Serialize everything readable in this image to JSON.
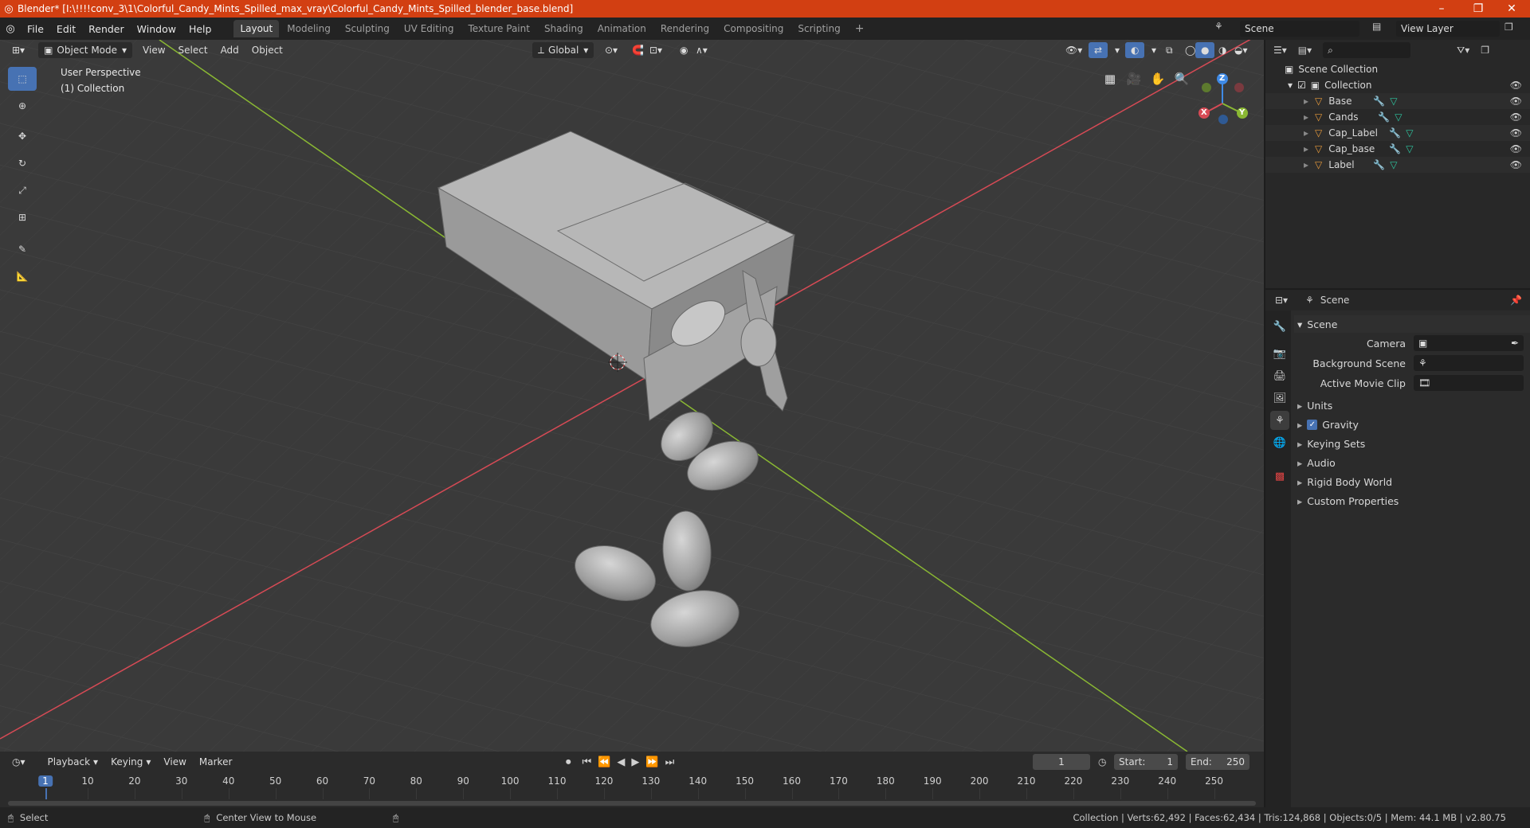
{
  "window": {
    "title": "Blender* [I:\\!!!!conv_3\\1\\Colorful_Candy_Mints_Spilled_max_vray\\Colorful_Candy_Mints_Spilled_blender_base.blend]",
    "minimize": "–",
    "maximize": "❐",
    "close": "✕"
  },
  "menu": [
    "File",
    "Edit",
    "Render",
    "Window",
    "Help"
  ],
  "workspaces": [
    {
      "label": "Layout",
      "active": true
    },
    {
      "label": "Modeling",
      "active": false
    },
    {
      "label": "Sculpting",
      "active": false
    },
    {
      "label": "UV Editing",
      "active": false
    },
    {
      "label": "Texture Paint",
      "active": false
    },
    {
      "label": "Shading",
      "active": false
    },
    {
      "label": "Animation",
      "active": false
    },
    {
      "label": "Rendering",
      "active": false
    },
    {
      "label": "Compositing",
      "active": false
    },
    {
      "label": "Scripting",
      "active": false
    }
  ],
  "topright": {
    "scene": "Scene",
    "view_layer": "View Layer"
  },
  "viewport_header": {
    "mode": "Object Mode",
    "menus": [
      "View",
      "Select",
      "Add",
      "Object"
    ],
    "transform": "Global"
  },
  "viewport": {
    "perspective": "User Perspective",
    "collection": "(1) Collection",
    "gizmo": {
      "x": "X",
      "y": "Y",
      "z": "Z"
    }
  },
  "outliner": {
    "root": "Scene Collection",
    "collection": "Collection",
    "objects": [
      "Base",
      "Cands",
      "Cap_Label",
      "Cap_base",
      "Label"
    ]
  },
  "properties": {
    "header": "Scene",
    "panel": "Scene",
    "fields": [
      {
        "label": "Camera",
        "value": ""
      },
      {
        "label": "Background Scene",
        "value": ""
      },
      {
        "label": "Active Movie Clip",
        "value": ""
      }
    ],
    "subpanels": [
      "Units",
      "Gravity",
      "Keying Sets",
      "Audio",
      "Rigid Body World",
      "Custom Properties"
    ]
  },
  "timeline": {
    "menus": [
      "Playback",
      "Keying",
      "View",
      "Marker"
    ],
    "current_frame": "1",
    "start_label": "Start:",
    "start": "1",
    "end_label": "End:",
    "end": "250",
    "ticks": [
      "1",
      "10",
      "20",
      "30",
      "40",
      "50",
      "60",
      "70",
      "80",
      "90",
      "100",
      "110",
      "120",
      "130",
      "140",
      "150",
      "160",
      "170",
      "180",
      "190",
      "200",
      "210",
      "220",
      "230",
      "240",
      "250"
    ]
  },
  "statusbar": {
    "left1": "Select",
    "left2": "Center View to Mouse",
    "right": "Collection | Verts:62,492 | Faces:62,434 | Tris:124,868 | Objects:0/5 | Mem: 44.1 MB | v2.80.75"
  },
  "colors": {
    "titlebar": "#d23f12",
    "accent": "#4772b3",
    "x_axis": "#d64a55",
    "y_axis": "#8ab833",
    "z_axis": "#3f8ae6",
    "mesh_icon": "#2ec6a0",
    "object_icon": "#e89b3c"
  }
}
